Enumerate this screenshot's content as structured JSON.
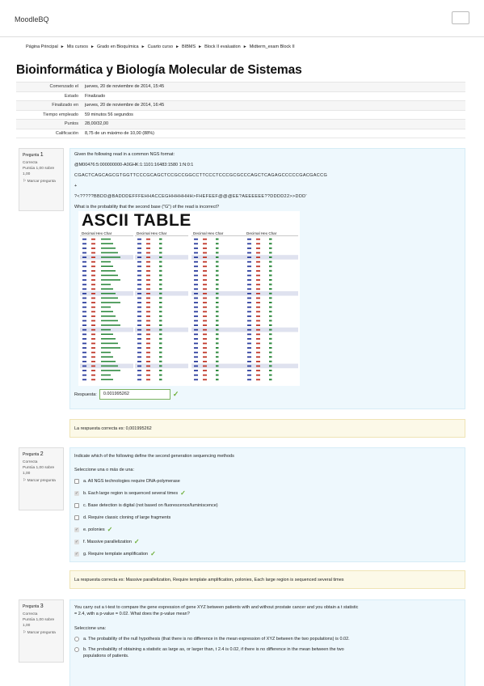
{
  "header": {
    "brand": "MoodleBQ"
  },
  "breadcrumb": [
    "Página Principal",
    "Mis cursos",
    "Grado en Bioquímica",
    "Cuarto curso",
    "BIBMS",
    "Block II evaluation",
    "Midterm_exam Block II"
  ],
  "page_title": "Bioinformática y Biología Molecular de Sistemas",
  "summary": [
    {
      "label": "Comenzado el",
      "value": "jueves, 20 de noviembre de 2014, 15:45"
    },
    {
      "label": "Estado",
      "value": "Finalizado"
    },
    {
      "label": "Finalizado en",
      "value": "jueves, 20 de noviembre de 2014, 16:45"
    },
    {
      "label": "Tiempo empleado",
      "value": "59 minutos 56 segundos"
    },
    {
      "label": "Puntos",
      "value": "28,00/32,00"
    },
    {
      "label": "Calificación",
      "value": "8,75 de un máximo de 10,00 (88%)"
    }
  ],
  "questions": [
    {
      "info": {
        "prefix": "Pregunta",
        "number": "1",
        "status": "Correcta",
        "points": "Puntúa 1,00 sobre 1,00",
        "flag": "Marcar pregunta"
      },
      "text": [
        "Given the following read in a common NGS format:",
        "@M00476:5:000000000-A0GHK:1:1101:16483:1580 1:N:0:1",
        "CGACTCAGCAGCGTGGTTCCCGCAGCTCCGCCGGCCTTCCCTCCCGCGCCCAGCTCAGAGCCCCCGACGACCG",
        "+",
        "?<?????BBDD@BADDDEFFFEHHACCEGHHHHHHH>FHEFEEF@@@EE?AEEEEEE??DDDD22>>DDD'",
        "What is the probability that the second base (\"G\") of the read is incorrect?"
      ],
      "ascii_title": "ASCII TABLE",
      "answer_label": "Respuesta:",
      "answer_value": "0.001995262",
      "feedback": "La respuesta correcta es: 0,001995262"
    },
    {
      "info": {
        "prefix": "Pregunta",
        "number": "2",
        "status": "Correcta",
        "points": "Puntúa 1,00 sobre 1,00",
        "flag": "Marcar pregunta"
      },
      "text": "Indicate which of the following define the second generation sequencing methods",
      "hint": "Seleccione una o más de una:",
      "options": [
        {
          "label": "a. All NGS technologies require DNA-polymerase",
          "checked": false,
          "correct": false
        },
        {
          "label": "b. Each large region is sequenced several times",
          "checked": true,
          "correct": true
        },
        {
          "label": "c. Base detection is digital (not based on fluorescence/luminiscence)",
          "checked": false,
          "correct": false
        },
        {
          "label": "d. Require classic cloning of large fragments",
          "checked": false,
          "correct": false
        },
        {
          "label": "e. polonies",
          "checked": true,
          "correct": true
        },
        {
          "label": "f. Massive parallelization",
          "checked": true,
          "correct": true
        },
        {
          "label": "g. Require template amplification",
          "checked": true,
          "correct": true
        }
      ],
      "feedback": "La respuesta correcta es: Massive parallelization, Require template amplification, polonies, Each large region is sequenced several times"
    },
    {
      "info": {
        "prefix": "Pregunta",
        "number": "3",
        "status": "Correcta",
        "points": "Puntúa 1,00 sobre 1,00",
        "flag": "Marcar pregunta"
      },
      "text": [
        "You carry out a t-test to compare the gene expression of gene XYZ between patients with and without prostate cancer and you obtain a t statistic",
        "= 2.4, with a p-value = 0.02. What does the p-value mean?"
      ],
      "hint": "Seleccione una:",
      "options": [
        {
          "label": "a. The probability of the null hypothesis (that there is no difference in the mean expression of XYZ between the two populations) is 0.02."
        },
        {
          "label": "b. The probability of obtaining a statistic as large as, or larger than, t 2.4 is 0.02, if there is no difference in the mean between the two",
          "label2": "populations of patients."
        }
      ]
    }
  ],
  "colors": {
    "correct": "#6dae37",
    "question_bg": "#eef8fd",
    "feedback_bg": "#fcf9e8"
  }
}
